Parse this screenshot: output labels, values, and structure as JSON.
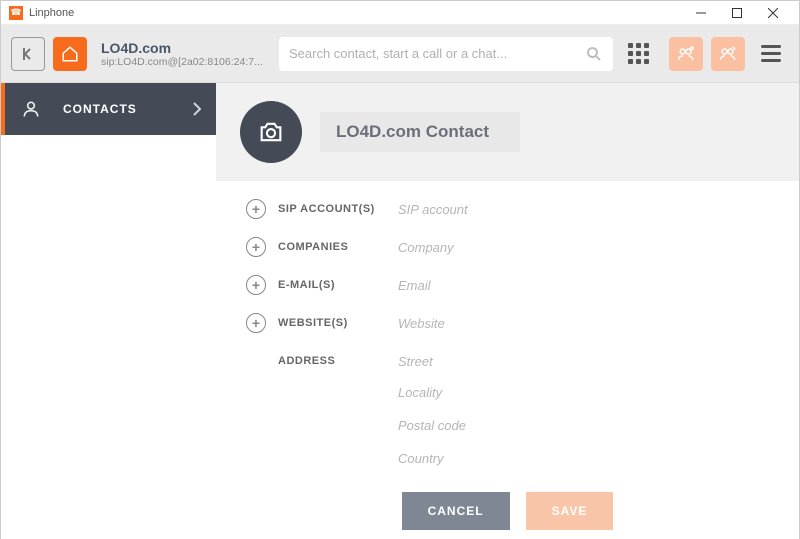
{
  "window": {
    "title": "Linphone"
  },
  "toolbar": {
    "identity_name": "LO4D.com",
    "identity_sip": "sip:LO4D.com@[2a02:8106:24:7...",
    "search_placeholder": "Search contact, start a call or a chat..."
  },
  "sidebar": {
    "contacts_label": "CONTACTS"
  },
  "contact": {
    "name": "LO4D.com Contact",
    "fields": {
      "sip_label": "SIP ACCOUNT(S)",
      "sip_placeholder": "SIP account",
      "companies_label": "COMPANIES",
      "companies_placeholder": "Company",
      "emails_label": "E-MAIL(S)",
      "emails_placeholder": "Email",
      "websites_label": "WEBSITE(S)",
      "websites_placeholder": "Website",
      "address_label": "ADDRESS",
      "street_placeholder": "Street",
      "locality_placeholder": "Locality",
      "postal_placeholder": "Postal code",
      "country_placeholder": "Country"
    }
  },
  "actions": {
    "cancel": "CANCEL",
    "save": "SAVE"
  }
}
